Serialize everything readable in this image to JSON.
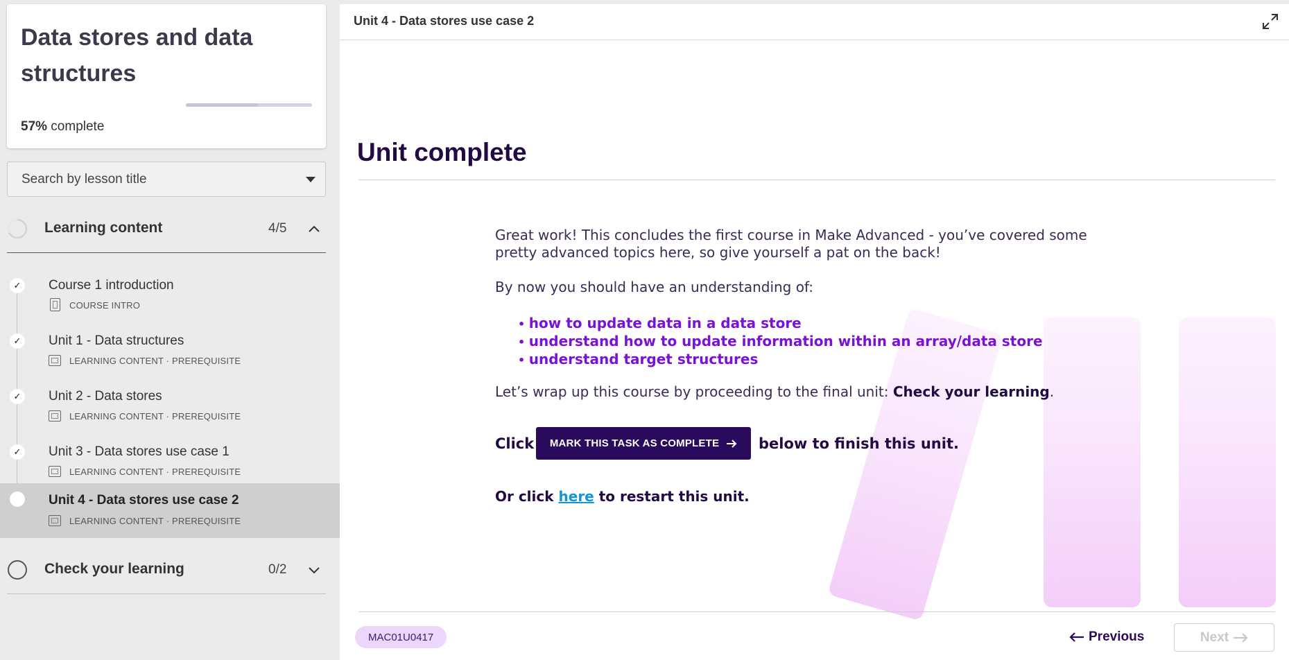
{
  "course": {
    "title": "Data stores and data structures",
    "progress_pct": "57%",
    "progress_suffix": " complete",
    "progress_value": 0.57
  },
  "search": {
    "placeholder": "Search by lesson title"
  },
  "sections": [
    {
      "title": "Learning content",
      "count": "4/5",
      "expanded": true
    },
    {
      "title": "Check your learning",
      "count": "0/2",
      "expanded": false
    }
  ],
  "lessons": [
    {
      "title": "Course 1 introduction",
      "meta": "COURSE INTRO",
      "icon": "document-icon",
      "completed": true
    },
    {
      "title": "Unit 1 - Data structures",
      "meta": "LEARNING CONTENT · PREREQUISITE",
      "icon": "slides-icon",
      "completed": true
    },
    {
      "title": "Unit 2 - Data stores",
      "meta": "LEARNING CONTENT · PREREQUISITE",
      "icon": "slides-icon",
      "completed": true
    },
    {
      "title": "Unit 3 - Data stores use case 1",
      "meta": "LEARNING CONTENT · PREREQUISITE",
      "icon": "slides-icon",
      "completed": true
    },
    {
      "title": "Unit 4 - Data stores use case 2",
      "meta": "LEARNING CONTENT · PREREQUISITE",
      "icon": "slides-icon",
      "completed": false,
      "active": true
    }
  ],
  "main": {
    "unit_title": "Unit 4 - Data stores use case 2",
    "heading": "Unit complete",
    "intro": "Great work! This concludes the first course in Make Advanced - you’ve covered some pretty advanced topics here, so give yourself a pat on the back!",
    "understanding_intro": "By now you should have an understanding of:",
    "bullets": [
      "how to update data in a data store",
      "understand how to update information within an array/data store",
      "understand target structures"
    ],
    "wrap_text": "Let’s wrap up this course by proceeding to the final unit: ",
    "wrap_bold": "Check your learning",
    "wrap_end": ".",
    "click_label": "Click",
    "mark_button": "MARK THIS TASK AS COMPLETE",
    "click_after": "below to finish this unit.",
    "restart_before": "Or click ",
    "restart_link": "here",
    "restart_after": " to restart this unit."
  },
  "footer": {
    "code": "MAC01U0417",
    "previous": "Previous",
    "next": "Next"
  },
  "colors": {
    "accent": "#2a0a5c",
    "bullet": "#7a12d4",
    "link": "#1493d8",
    "badge_bg": "#ecd6fb",
    "deco": "#f6d6fb"
  }
}
